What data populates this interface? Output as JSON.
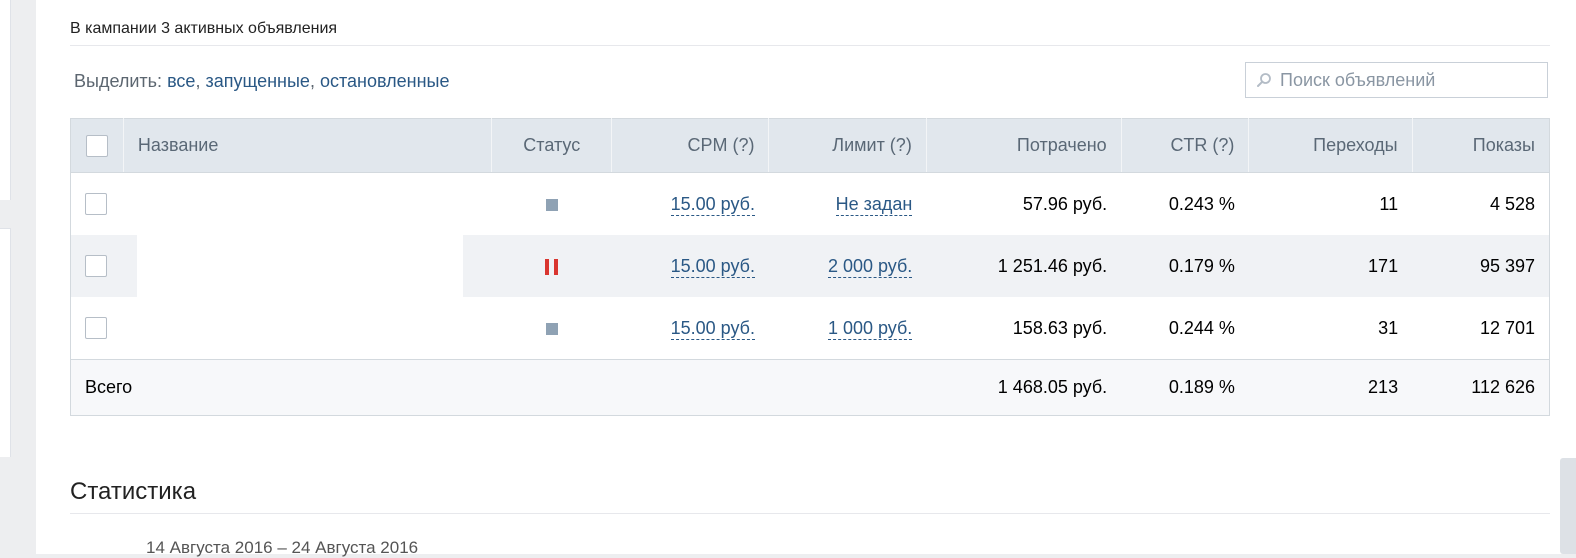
{
  "campaign": {
    "summary": "В кампании 3 активных объявления"
  },
  "filters": {
    "label": "Выделить:",
    "all": "все",
    "running": "запущенные",
    "stopped": "остановленные"
  },
  "search": {
    "placeholder": "Поиск объявлений"
  },
  "table": {
    "headers": {
      "name": "Название",
      "status": "Статус",
      "cpm": "CPM (?)",
      "limit": "Лимит (?)",
      "spent": "Потрачено",
      "ctr": "CTR (?)",
      "clicks": "Переходы",
      "views": "Показы"
    },
    "rows": [
      {
        "status": "stopped",
        "cpm": "15.00 руб.",
        "limit": "Не задан",
        "spent": "57.96 руб.",
        "ctr": "0.243 %",
        "clicks": "11",
        "views": "4 528"
      },
      {
        "status": "paused",
        "cpm": "15.00 руб.",
        "limit": "2 000 руб.",
        "spent": "1 251.46 руб.",
        "ctr": "0.179 %",
        "clicks": "171",
        "views": "95 397"
      },
      {
        "status": "stopped",
        "cpm": "15.00 руб.",
        "limit": "1 000 руб.",
        "spent": "158.63 руб.",
        "ctr": "0.244 %",
        "clicks": "31",
        "views": "12 701"
      }
    ],
    "total": {
      "label": "Всего",
      "spent": "1 468.05 руб.",
      "ctr": "0.189 %",
      "clicks": "213",
      "views": "112 626"
    }
  },
  "stats": {
    "title": "Статистика",
    "date_range": "14 Августа 2016 – 24 Августа 2016"
  },
  "colors": {
    "link": "#2a5885",
    "header_bg": "#e1e7ed",
    "pause_red": "#d9352f",
    "stop_gray": "#8fa2b4"
  }
}
